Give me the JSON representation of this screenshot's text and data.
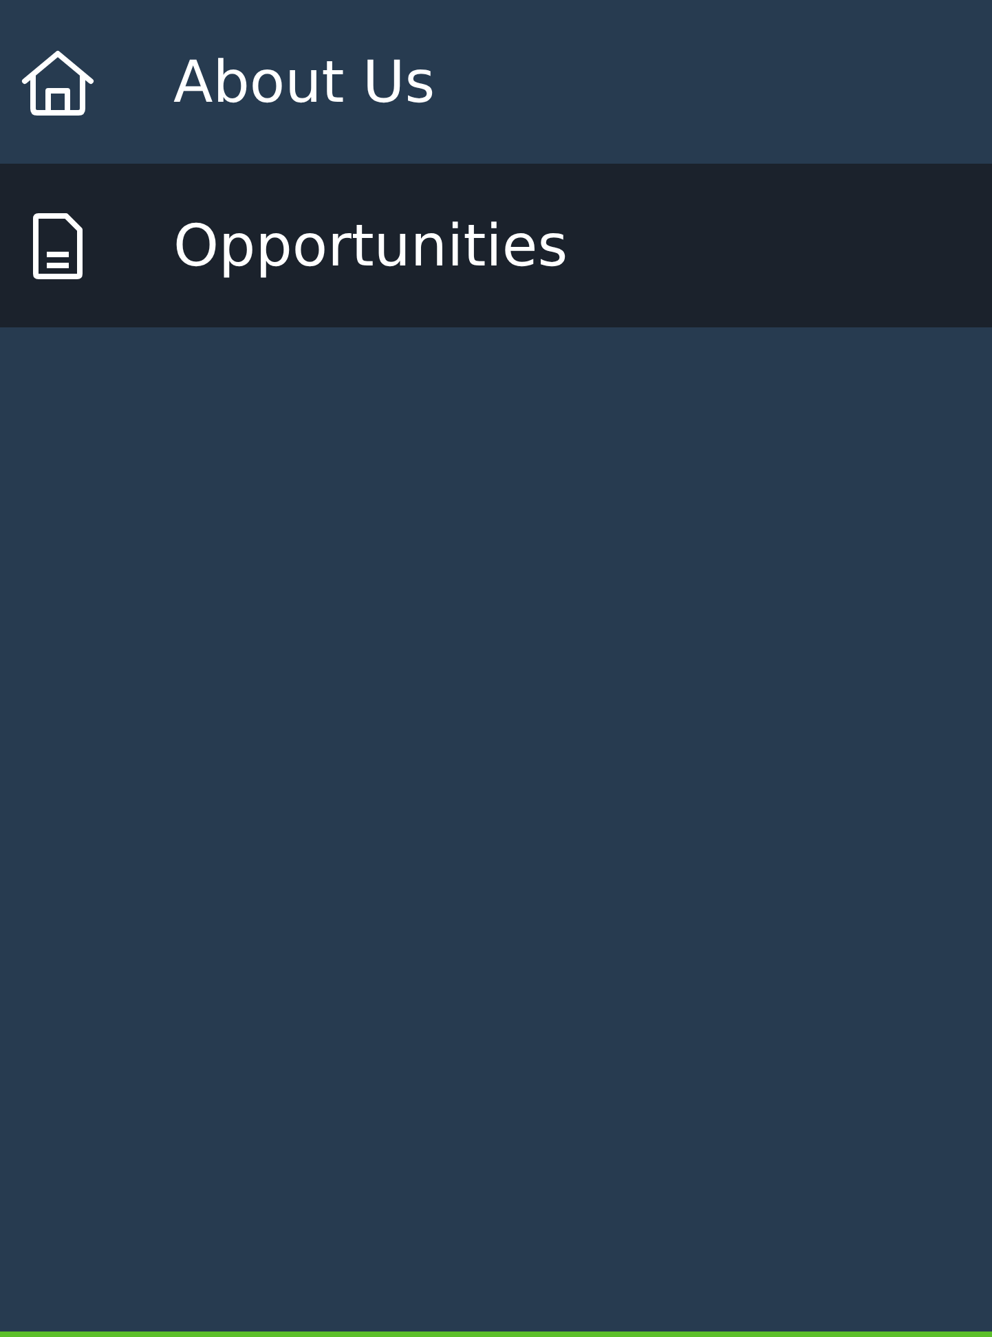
{
  "menu": {
    "items": [
      {
        "label": "About Us",
        "kind": "home",
        "selected": false
      },
      {
        "label": "Opportunities",
        "kind": "document",
        "selected": true
      }
    ]
  }
}
